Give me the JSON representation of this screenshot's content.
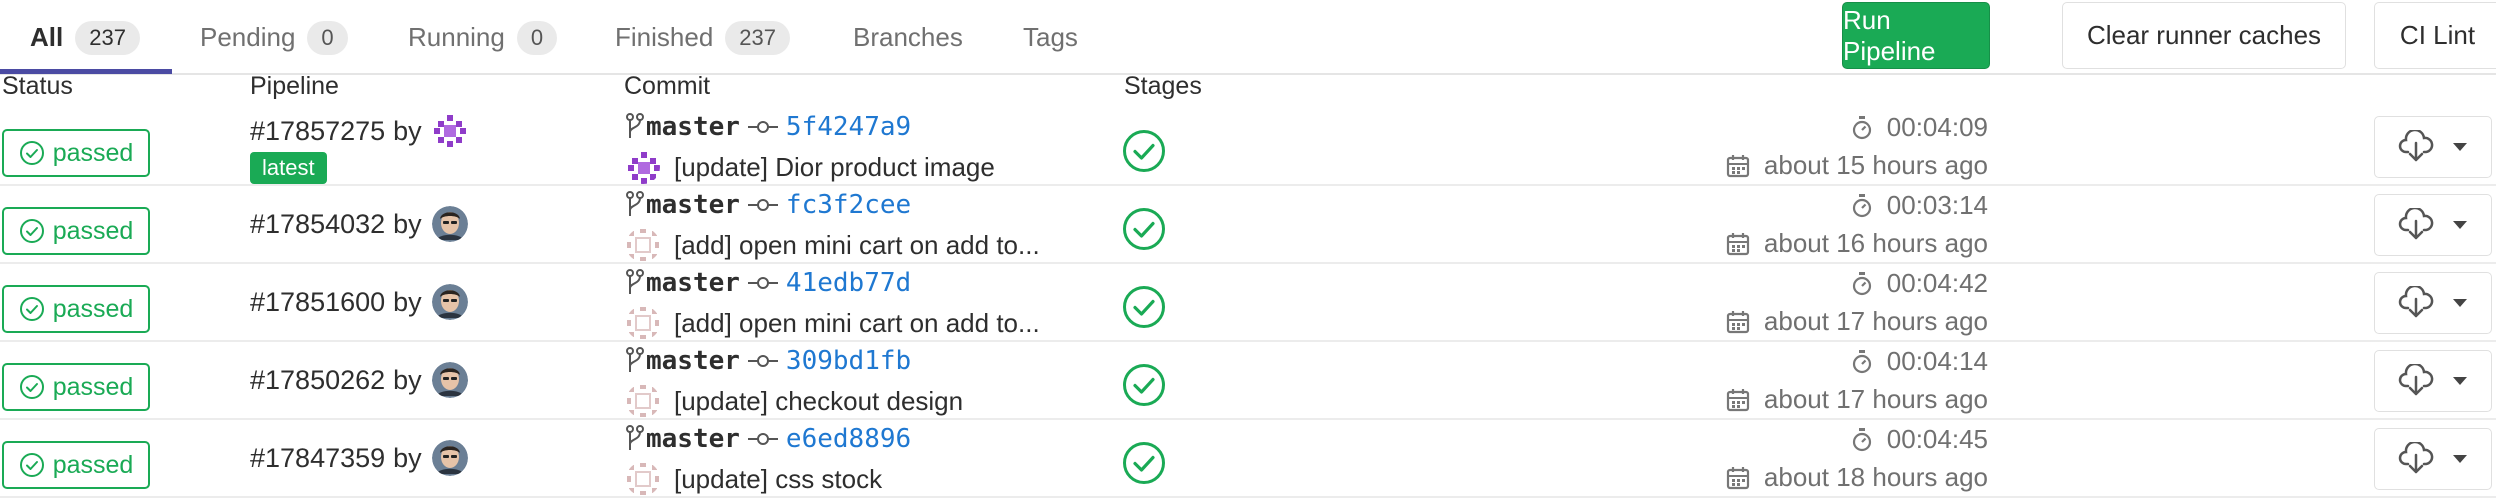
{
  "tabs": [
    {
      "label": "All",
      "count": "237",
      "active": true
    },
    {
      "label": "Pending",
      "count": "0"
    },
    {
      "label": "Running",
      "count": "0"
    },
    {
      "label": "Finished",
      "count": "237"
    },
    {
      "label": "Branches"
    },
    {
      "label": "Tags"
    }
  ],
  "actions": {
    "run_pipeline": "Run Pipeline",
    "clear_caches": "Clear runner caches",
    "ci_lint": "CI Lint"
  },
  "columns": {
    "status": "Status",
    "pipeline": "Pipeline",
    "commit": "Commit",
    "stages": "Stages"
  },
  "colors": {
    "success": "#1aaa55",
    "link": "#1f78d1",
    "tab_underline": "#4b4ba3"
  },
  "rows": [
    {
      "status": "passed",
      "pipeline": "#17857275",
      "by": "by",
      "latest": "latest",
      "branch": "master",
      "sha": "5f4247a9",
      "message": "[update] Dior product image",
      "duration": "00:04:09",
      "finished": "about 15 hours ago",
      "avatar": "identicon-purple"
    },
    {
      "status": "passed",
      "pipeline": "#17854032",
      "by": "by",
      "branch": "master",
      "sha": "fc3f2cee",
      "message": "[add] open mini cart on add to...",
      "duration": "00:03:14",
      "finished": "about 16 hours ago",
      "avatar": "user-photo"
    },
    {
      "status": "passed",
      "pipeline": "#17851600",
      "by": "by",
      "branch": "master",
      "sha": "41edb77d",
      "message": "[add] open mini cart on add to...",
      "duration": "00:04:42",
      "finished": "about 17 hours ago",
      "avatar": "user-photo"
    },
    {
      "status": "passed",
      "pipeline": "#17850262",
      "by": "by",
      "branch": "master",
      "sha": "309bd1fb",
      "message": "[update] checkout design",
      "duration": "00:04:14",
      "finished": "about 17 hours ago",
      "avatar": "user-photo"
    },
    {
      "status": "passed",
      "pipeline": "#17847359",
      "by": "by",
      "branch": "master",
      "sha": "e6ed8896",
      "message": "[update] css stock",
      "duration": "00:04:45",
      "finished": "about 18 hours ago",
      "avatar": "user-photo"
    }
  ]
}
